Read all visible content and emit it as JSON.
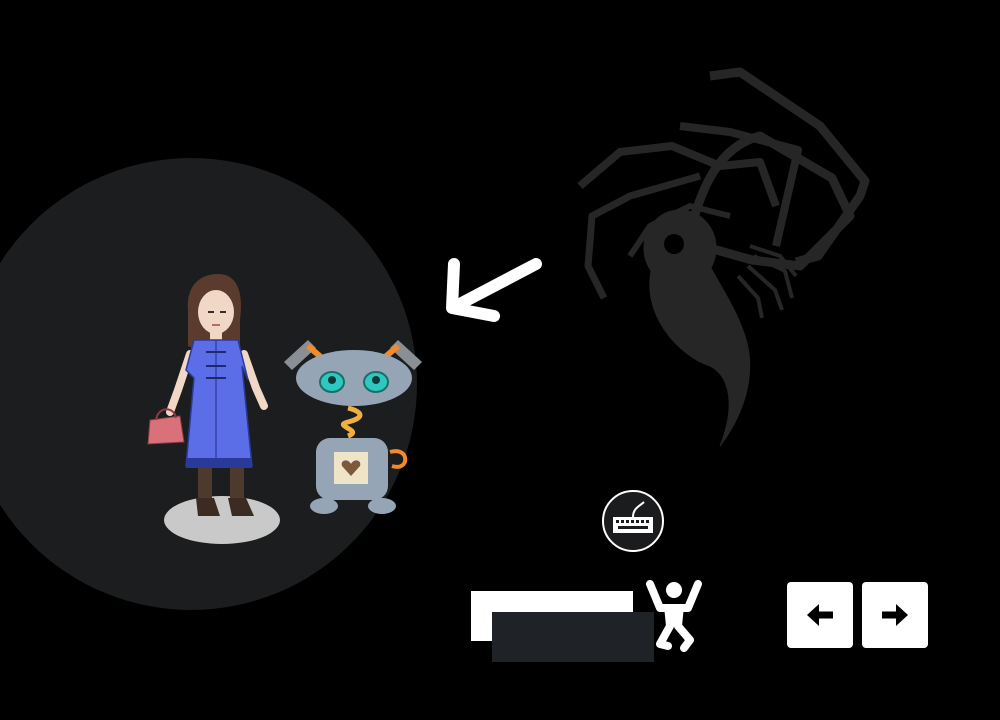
{
  "scene": {
    "background_color": "#000000",
    "spotlight_color": "#1b1d1e",
    "spider_color": "#262626"
  },
  "characters": {
    "girl": {
      "dress_color": "#5b6ee8",
      "bag_color": "#d9707a"
    },
    "robot": {
      "body_color": "#95a5b5",
      "eye_color": "#2fc8c0",
      "accent_color": "#f28a2c"
    }
  },
  "controls": {
    "keyboard_icon": "keyboard-icon",
    "jump_icon": "jump-figure-icon",
    "left_icon": "arrow-left-icon",
    "right_icon": "arrow-right-icon",
    "bar_white_color": "#ffffff",
    "bar_dark_color": "#1f2327"
  }
}
